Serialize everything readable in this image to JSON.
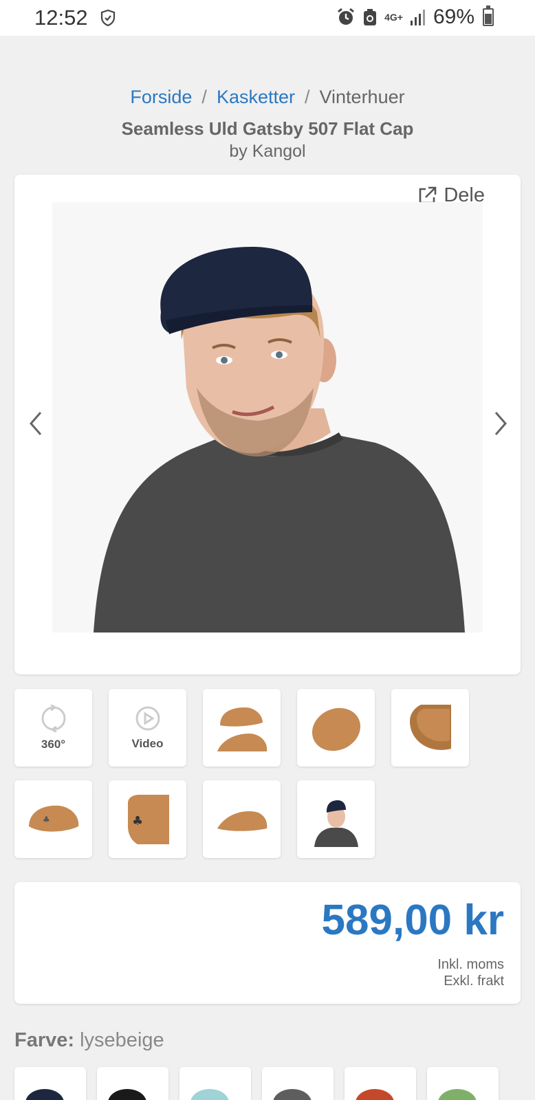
{
  "status_bar": {
    "time": "12:52",
    "network": "4G+",
    "battery": "69%",
    "battery_level": 0.69
  },
  "breadcrumb": {
    "home": "Forside",
    "category": "Kasketter",
    "current": "Vinterhuer",
    "separator": "/"
  },
  "product": {
    "title": "Seamless Uld Gatsby 507 Flat Cap",
    "byline": "by Kangol"
  },
  "gallery": {
    "share_label": "Dele"
  },
  "thumbnails": [
    {
      "label": "360°",
      "icon": "rotate-360-icon"
    },
    {
      "label": "Video",
      "icon": "play-icon"
    },
    {
      "label": "",
      "icon": "cap-stack-image"
    },
    {
      "label": "",
      "icon": "cap-top-image"
    },
    {
      "label": "",
      "icon": "cap-inside-image"
    },
    {
      "label": "",
      "icon": "cap-side-image"
    },
    {
      "label": "",
      "icon": "cap-back-logo-image"
    },
    {
      "label": "",
      "icon": "cap-profile-image"
    },
    {
      "label": "",
      "icon": "model-image"
    }
  ],
  "price": {
    "amount": "589,00 kr",
    "vat": "Inkl. moms",
    "shipping": "Exkl. frakt"
  },
  "color": {
    "label": "Farve:",
    "value": "lysebeige"
  },
  "swatches": [
    {
      "name": "navy",
      "color": "#1d2740"
    },
    {
      "name": "black",
      "color": "#1a1a1a"
    },
    {
      "name": "light-blue",
      "color": "#9fd3d6"
    },
    {
      "name": "grey",
      "color": "#5e5e5e"
    },
    {
      "name": "orange",
      "color": "#c6482a"
    },
    {
      "name": "green",
      "color": "#7fb06a"
    }
  ],
  "colors": {
    "accent": "#2b78c2",
    "background": "#f0f0f0",
    "cap_tan": "#c68a52"
  }
}
